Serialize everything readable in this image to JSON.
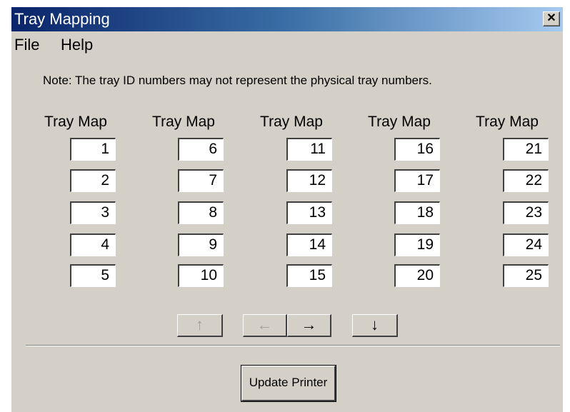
{
  "window": {
    "title": "Tray Mapping",
    "close_label": "✕"
  },
  "menu": {
    "file": "File",
    "help": "Help"
  },
  "note": "Note:  The tray ID numbers may not represent the physical tray numbers.",
  "columns": [
    {
      "header": "Tray Map",
      "values": [
        "1",
        "2",
        "3",
        "4",
        "5"
      ]
    },
    {
      "header": "Tray Map",
      "values": [
        "6",
        "7",
        "8",
        "9",
        "10"
      ]
    },
    {
      "header": "Tray Map",
      "values": [
        "11",
        "12",
        "13",
        "14",
        "15"
      ]
    },
    {
      "header": "Tray Map",
      "values": [
        "16",
        "17",
        "18",
        "19",
        "20"
      ]
    },
    {
      "header": "Tray Map",
      "values": [
        "21",
        "22",
        "23",
        "24",
        "25"
      ]
    }
  ],
  "nav": {
    "up": "↑",
    "left": "←",
    "right": "→",
    "down": "↓"
  },
  "update_button": "Update Printer"
}
